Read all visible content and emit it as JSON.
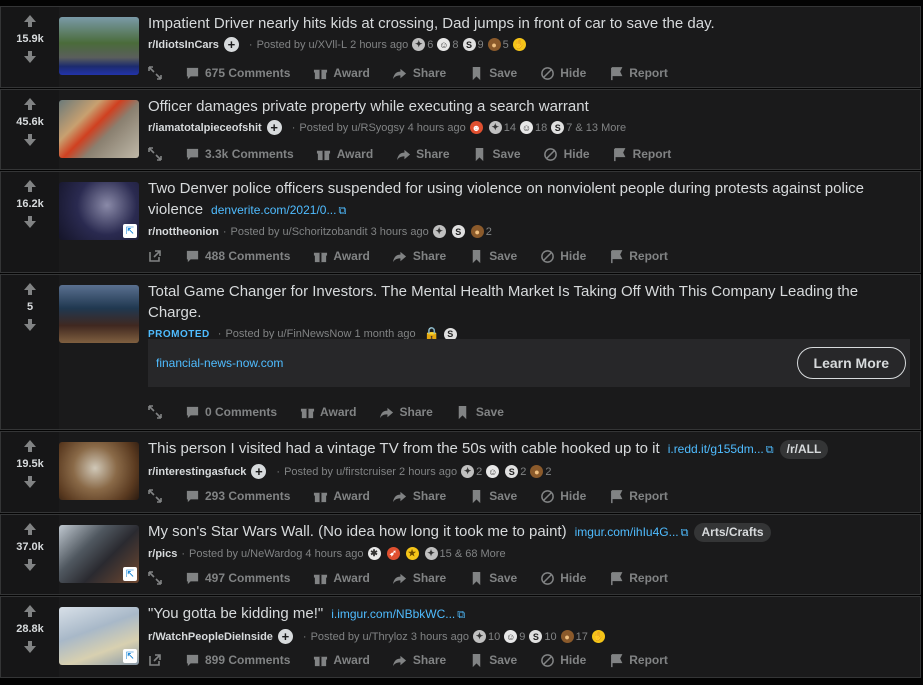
{
  "actions": {
    "award": "Award",
    "share": "Share",
    "save": "Save",
    "hide": "Hide",
    "report": "Report"
  },
  "posts": [
    {
      "score": "15.9k",
      "title": "Impatient Driver nearly hits kids at crossing, Dad jumps in front of car to save the day.",
      "subreddit": "r/IdiotsInCars",
      "posted_by": "Posted by u/XVll-L",
      "time": "2 hours ago",
      "awards": [
        "6",
        "8",
        "9",
        "5"
      ],
      "comments": "675 Comments"
    },
    {
      "score": "45.6k",
      "title": "Officer damages private property while executing a search warrant",
      "subreddit": "r/iamatotalpieceofshit",
      "posted_by": "Posted by u/RSyogsy",
      "time": "4 hours ago",
      "awards": [
        "14",
        "18",
        "7 & 13 More"
      ],
      "comments": "3.3k Comments"
    },
    {
      "score": "16.2k",
      "title": "Two Denver police officers suspended for using violence on nonviolent people during protests against police violence",
      "link": "denverite.com/2021/0...",
      "subreddit": "r/nottheonion",
      "posted_by": "Posted by u/Schoritzobandit",
      "time": "3 hours ago",
      "awards": [
        "2"
      ],
      "comments": "488 Comments"
    },
    {
      "score": "5",
      "title": "Total Game Changer for Investors. The Mental Health Market Is Taking Off With This Company Leading the Charge.",
      "promoted": "PROMOTED",
      "posted_by": "Posted by u/FinNewsNow",
      "time": "1 month ago",
      "domain": "financial-news-now.com",
      "cta": "Learn More",
      "comments": "0 Comments"
    },
    {
      "score": "19.5k",
      "title": "This person I visited had a vintage TV from the 50s with cable hooked up to it",
      "link": "i.redd.it/g155dm...",
      "flair": "/r/ALL",
      "subreddit": "r/interestingasfuck",
      "posted_by": "Posted by u/firstcruiser",
      "time": "2 hours ago",
      "awards": [
        "2",
        "2",
        "2"
      ],
      "comments": "293 Comments"
    },
    {
      "score": "37.0k",
      "title": "My son's Star Wars Wall. (No idea how long it took me to paint)",
      "link": "imgur.com/ihIu4G...",
      "flair": "Arts/Crafts",
      "subreddit": "r/pics",
      "posted_by": "Posted by u/NeWardog",
      "time": "4 hours ago",
      "awards": [
        "15 & 68 More"
      ],
      "comments": "497 Comments"
    },
    {
      "score": "28.8k",
      "title": "\"You gotta be kidding me!\"",
      "link": "i.imgur.com/NBbkWC...",
      "subreddit": "r/WatchPeopleDieInside",
      "posted_by": "Posted by u/Thryloz",
      "time": "3 hours ago",
      "awards": [
        "10",
        "9",
        "10",
        "17"
      ],
      "comments": "899 Comments"
    }
  ],
  "colors": {
    "background": "#030303",
    "card": "#1a1a1b",
    "link": "#4fbcff",
    "muted": "#818384"
  }
}
